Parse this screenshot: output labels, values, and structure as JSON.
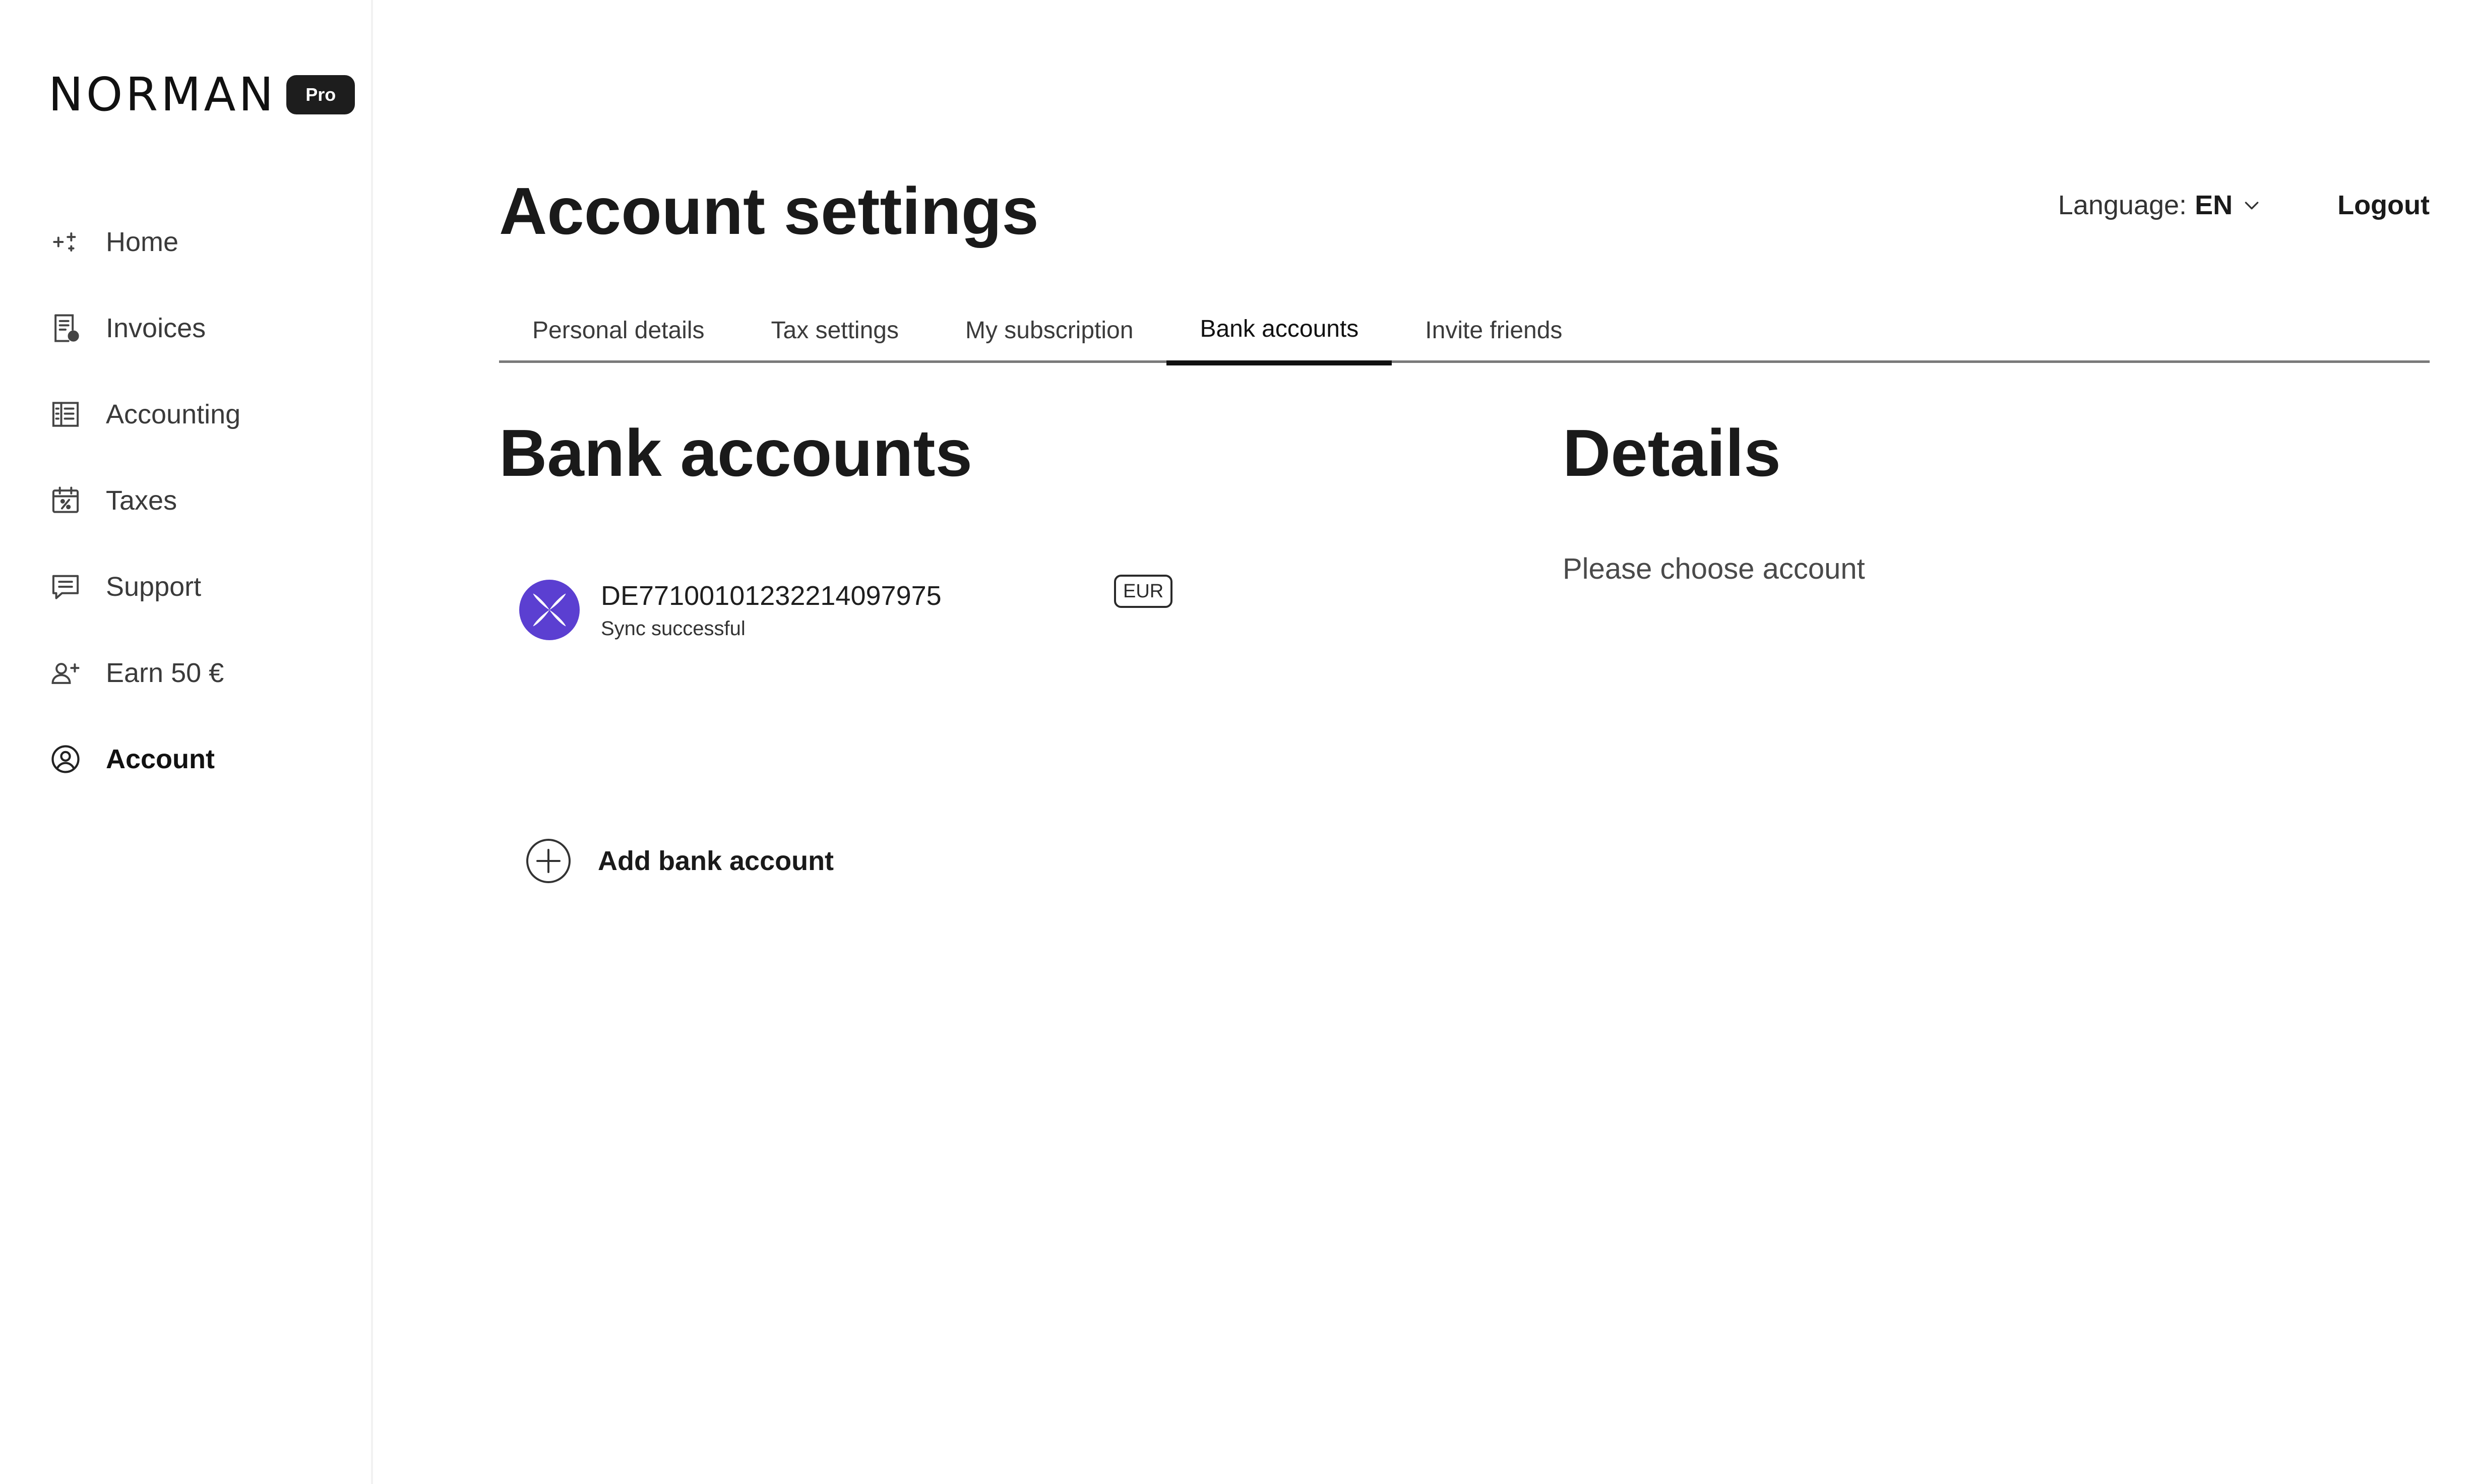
{
  "brand": {
    "name": "NORMAN",
    "badge": "Pro"
  },
  "sidebar": {
    "items": [
      {
        "label": "Home",
        "icon": "sparkle-icon"
      },
      {
        "label": "Invoices",
        "icon": "invoice-icon"
      },
      {
        "label": "Accounting",
        "icon": "ledger-icon"
      },
      {
        "label": "Taxes",
        "icon": "calendar-percent-icon"
      },
      {
        "label": "Support",
        "icon": "chat-icon"
      },
      {
        "label": "Earn 50 €",
        "icon": "user-plus-icon"
      },
      {
        "label": "Account",
        "icon": "user-circle-icon",
        "active": true
      }
    ]
  },
  "header": {
    "title": "Account settings",
    "language_label": "Language:",
    "language_code": "EN",
    "logout_label": "Logout"
  },
  "tabs": [
    {
      "label": "Personal details"
    },
    {
      "label": "Tax settings"
    },
    {
      "label": "My subscription"
    },
    {
      "label": "Bank accounts",
      "active": true
    },
    {
      "label": "Invite friends"
    }
  ],
  "bank_accounts": {
    "title": "Bank accounts",
    "accounts": [
      {
        "iban": "DE77100101232214097975",
        "status": "Sync successful",
        "currency": "EUR",
        "logo_color": "#5b3fd1"
      }
    ],
    "add_label": "Add bank account"
  },
  "details": {
    "title": "Details",
    "empty_message": "Please choose account"
  },
  "colors": {
    "text": "#1a1a1a",
    "tab_underline": "#111111",
    "divider": "#7a7a7a",
    "bank_logo": "#5b3fd1"
  }
}
